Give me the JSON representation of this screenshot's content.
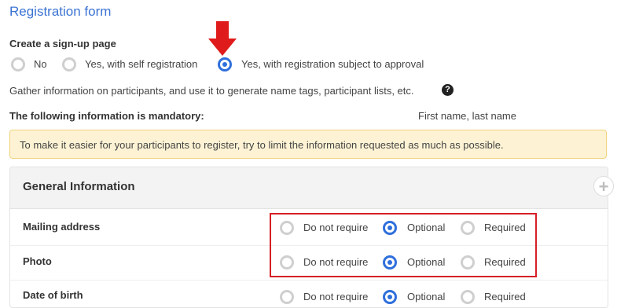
{
  "title": "Registration form",
  "signup": {
    "label": "Create a sign-up page",
    "options": [
      "No",
      "Yes, with self registration",
      "Yes, with registration subject to approval"
    ],
    "selected": "Yes, with registration subject to approval"
  },
  "gather_text": "Gather information on participants, and use it to generate name tags, participant lists, etc.",
  "help_glyph": "?",
  "mandatory": {
    "label": "The following information is mandatory:",
    "value": "First name, last name"
  },
  "notice": "To make it easier for your participants to register, try to limit the information requested as much as possible.",
  "panel": {
    "title": "General Information",
    "add_glyph": "+"
  },
  "requirement_options": [
    "Do not require",
    "Optional",
    "Required"
  ],
  "fields": [
    {
      "label": "Mailing address",
      "selected": "Optional"
    },
    {
      "label": "Photo",
      "selected": "Optional"
    },
    {
      "label": "Date of birth",
      "selected": "Optional"
    }
  ],
  "colors": {
    "accent": "#2f6fdc",
    "title": "#3b73d4",
    "highlight": "#d61f26",
    "notice_bg": "#fdf3d4"
  }
}
